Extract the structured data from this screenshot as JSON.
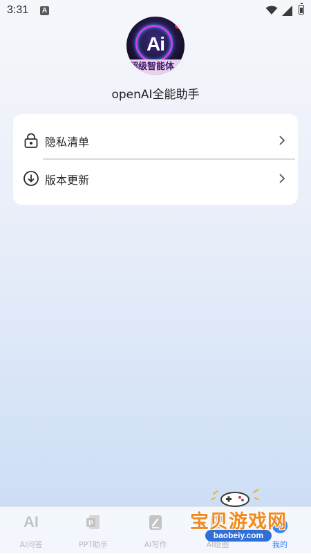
{
  "status_bar": {
    "time": "3:31",
    "notification_icon": "A"
  },
  "profile": {
    "logo_text": "Ai",
    "logo_banner": "超级智能体",
    "app_name": "openAI全能助手"
  },
  "menu": {
    "items": [
      {
        "label": "隐私清单",
        "icon": "lock-icon"
      },
      {
        "label": "版本更新",
        "icon": "download-circle-icon"
      }
    ]
  },
  "bottom_nav": {
    "active_index": 4,
    "active_color": "#3b82f6",
    "inactive_color": "#b8b8b8",
    "items": [
      {
        "label": "AI问答",
        "icon": "ai-text-icon"
      },
      {
        "label": "PPT助手",
        "icon": "ppt-icon"
      },
      {
        "label": "AI写作",
        "icon": "pen-note-icon"
      },
      {
        "label": "AI绘图",
        "icon": "image-icon"
      },
      {
        "label": "我的",
        "icon": "profile-icon"
      }
    ]
  },
  "watermark": {
    "title": "宝贝游戏网",
    "url": "baobeiy.com"
  }
}
